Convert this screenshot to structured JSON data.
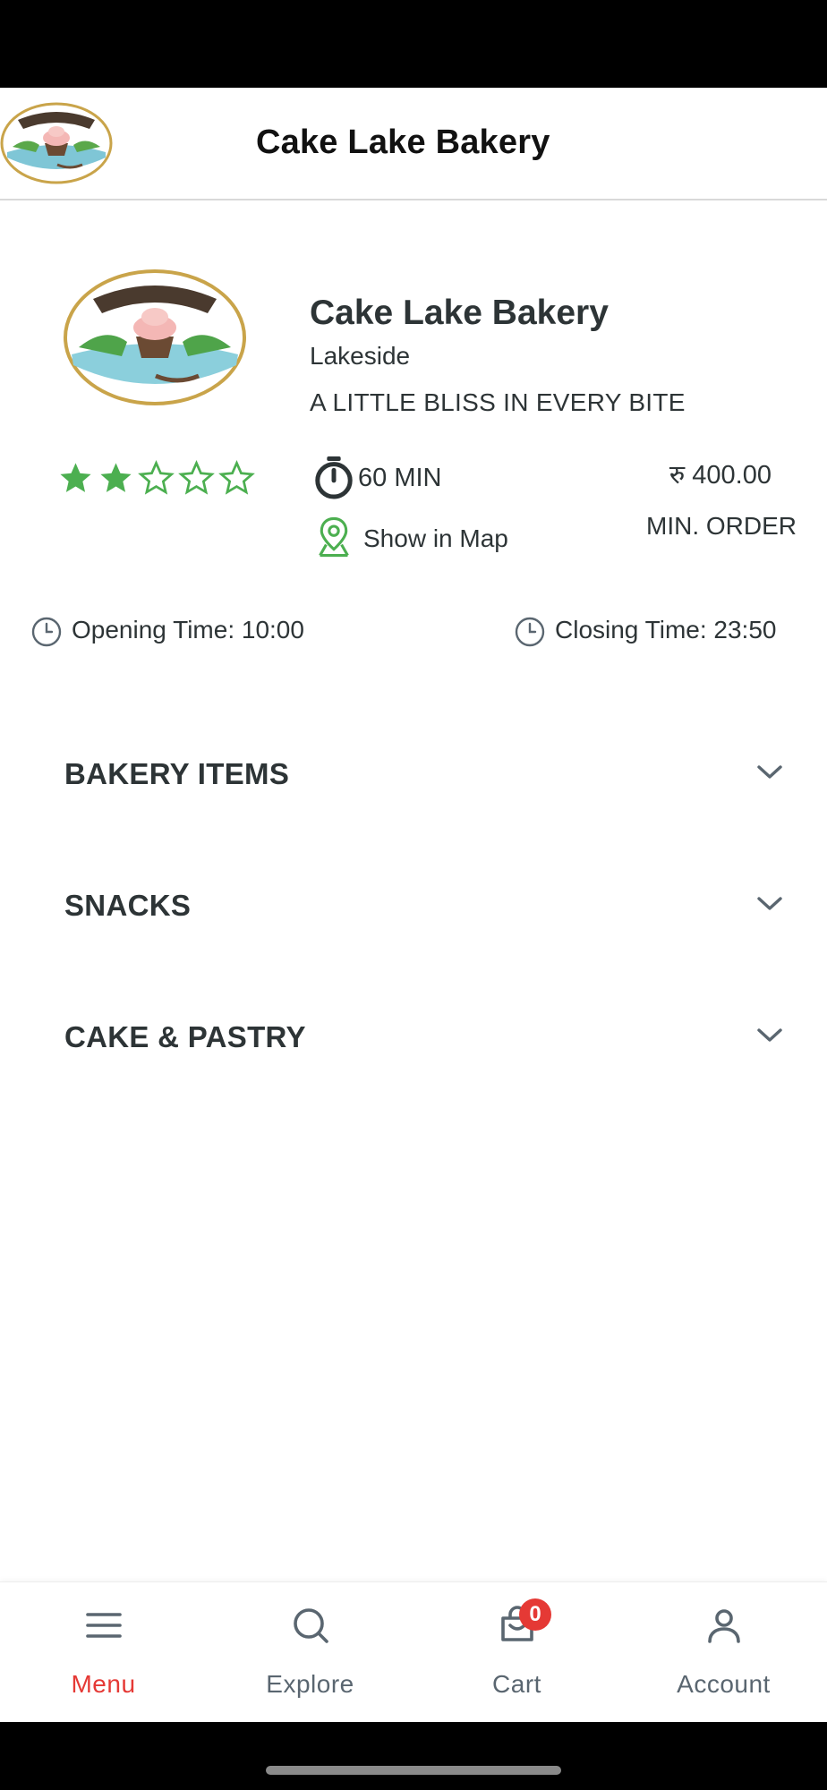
{
  "header": {
    "title": "Cake Lake Bakery",
    "logo_icon": "bakery-logo"
  },
  "store": {
    "name": "Cake Lake Bakery",
    "location": "Lakeside",
    "tagline": "A LITTLE BLISS IN EVERY BITE",
    "rating": 2,
    "rating_max": 5,
    "delivery_time": "60 MIN",
    "show_in_map": "Show in Map",
    "min_order_price": "रु 400.00",
    "min_order_label": "MIN. ORDER",
    "opening_time": "Opening Time: 10:00",
    "closing_time": "Closing Time: 23:50"
  },
  "categories": [
    {
      "label": "BAKERY ITEMS"
    },
    {
      "label": "SNACKS"
    },
    {
      "label": "CAKE & PASTRY"
    }
  ],
  "bottom_nav": {
    "items": [
      {
        "label": "Menu",
        "icon": "menu-icon",
        "active": true
      },
      {
        "label": "Explore",
        "icon": "search-icon",
        "active": false
      },
      {
        "label": "Cart",
        "icon": "cart-icon",
        "active": false
      },
      {
        "label": "Account",
        "icon": "user-icon",
        "active": false
      }
    ],
    "cart_badge": "0"
  },
  "colors": {
    "accent_green": "#4caf50",
    "active_red": "#e53935",
    "text_dark": "#2d3436"
  }
}
